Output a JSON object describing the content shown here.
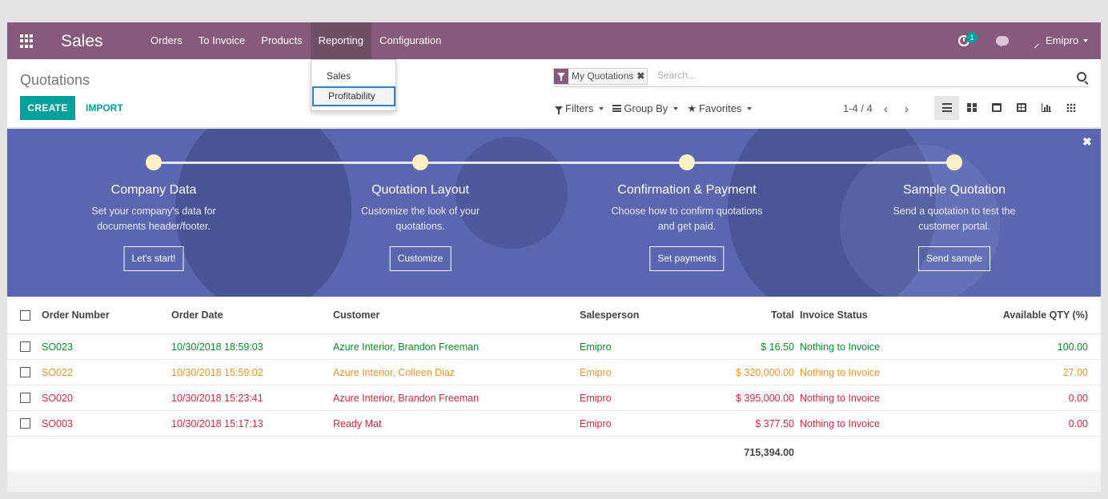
{
  "navbar": {
    "app_title": "Sales",
    "menu": [
      "Orders",
      "To Invoice",
      "Products",
      "Reporting",
      "Configuration"
    ],
    "activity_count": "1",
    "user": "Emipro"
  },
  "reporting_menu": [
    "Sales",
    "Profitability"
  ],
  "control_panel": {
    "breadcrumb": "Quotations",
    "create_label": "CREATE",
    "import_label": "IMPORT",
    "search_facet": "My Quotations",
    "search_placeholder": "Search...",
    "filters_label": "Filters",
    "groupby_label": "Group By",
    "favorites_label": "Favorites",
    "pager": "1-4 / 4"
  },
  "banner": {
    "steps": [
      {
        "title": "Company Data",
        "desc": "Set your company's data for documents header/footer.",
        "button": "Let's start!"
      },
      {
        "title": "Quotation Layout",
        "desc": "Customize the look of your quotations.",
        "button": "Customize"
      },
      {
        "title": "Confirmation & Payment",
        "desc": "Choose how to confirm quotations and get paid.",
        "button": "Set payments"
      },
      {
        "title": "Sample Quotation",
        "desc": "Send a quotation to test the customer portal.",
        "button": "Send sample"
      }
    ]
  },
  "table": {
    "columns": [
      "Order Number",
      "Order Date",
      "Customer",
      "Salesperson",
      "Total",
      "Invoice Status",
      "Available QTY (%)"
    ],
    "rows": [
      {
        "number": "SO023",
        "date": "10/30/2018 18:59:03",
        "customer": "Azure Interior, Brandon Freeman",
        "salesperson": "Emipro",
        "total": "$ 16.50",
        "invoice": "Nothing to Invoice",
        "qty": "100.00",
        "color": "#0a8a2c"
      },
      {
        "number": "SO022",
        "date": "10/30/2018 15:59:02",
        "customer": "Azure Interior, Colleen Diaz",
        "salesperson": "Emipro",
        "total": "$ 320,000.00",
        "invoice": "Nothing to Invoice",
        "qty": "27.00",
        "color": "#e0952a"
      },
      {
        "number": "SO020",
        "date": "10/30/2018 15:23:41",
        "customer": "Azure Interior, Brandon Freeman",
        "salesperson": "Emipro",
        "total": "$ 395,000.00",
        "invoice": "Nothing to Invoice",
        "qty": "0.00",
        "color": "#d3283b"
      },
      {
        "number": "SO003",
        "date": "10/30/2018 15:17:13",
        "customer": "Ready Mat",
        "salesperson": "Emipro",
        "total": "$ 377.50",
        "invoice": "Nothing to Invoice",
        "qty": "0.00",
        "color": "#d3283b"
      }
    ],
    "footer_total": "715,394.00"
  },
  "colors": {
    "brand": "#875a7b",
    "accent": "#00a09d",
    "banner": "#5a67b0"
  }
}
